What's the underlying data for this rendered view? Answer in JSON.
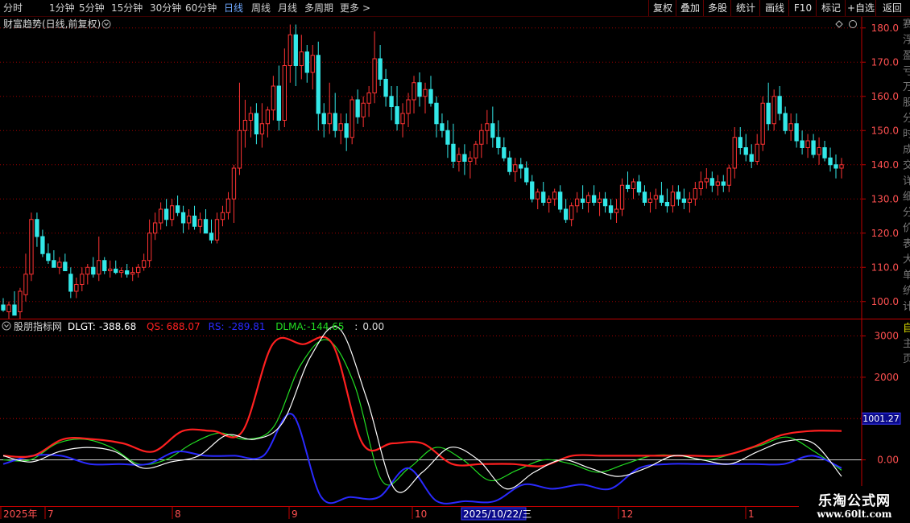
{
  "toolbar": {
    "periods": [
      "分时",
      "1分钟",
      "5分钟",
      "15分钟",
      "30分钟",
      "60分钟",
      "日线",
      "周线",
      "月线",
      "多周期",
      "更多"
    ],
    "active_period": "日线",
    "more_arrow": ">",
    "buttons": [
      "复权",
      "叠加",
      "多股",
      "统计",
      "画线",
      "F10",
      "标记",
      "+自选",
      "返回"
    ]
  },
  "main_panel": {
    "title": "财富趋势(日线,前复权)",
    "y_ticks": [
      "180.0",
      "170.0",
      "160.0",
      "150.0",
      "140.0",
      "130.0",
      "120.0",
      "110.0",
      "100.0"
    ]
  },
  "indicator_panel": {
    "name": "股朋指标网",
    "readouts": [
      {
        "label": "DLGT:",
        "value": "-388.68",
        "color": "#ffffff"
      },
      {
        "label": "QS:",
        "value": "688.07",
        "color": "#ff2020"
      },
      {
        "label": "RS:",
        "value": "-289.81",
        "color": "#2a2aff"
      },
      {
        "label": "DLMA:",
        "value": "-144.65",
        "color": "#22dd22"
      },
      {
        "label": ":",
        "value": "0.00",
        "color": "#dddddd"
      }
    ],
    "y_ticks": [
      "3000",
      "2000",
      "1000",
      "0.00"
    ],
    "cursor_value": "1001.27"
  },
  "time_axis": {
    "labels": [
      "2025年",
      "7",
      "8",
      "9",
      "10",
      "2025/10/22/三",
      "12",
      "1"
    ]
  },
  "side_strip": {
    "top_chars": [
      "赛",
      "浮",
      "盈",
      "亏",
      "万",
      "股",
      "分",
      "时",
      "成",
      "交",
      "详",
      "细",
      "分",
      "价",
      "表",
      "大",
      "单",
      "统",
      "计"
    ],
    "bottom_chars": [
      "自",
      "主",
      "页"
    ]
  },
  "watermark": {
    "title": "乐淘公式网",
    "url": "www.60lt.com"
  },
  "colors": {
    "up": "#ff3333",
    "down": "#33e8e8",
    "grid": "#a00000",
    "axis": "#c00000",
    "ma_white": "#ffffff"
  },
  "chart_data": [
    {
      "type": "candlestick",
      "title": "财富趋势(日线,前复权)",
      "ylim": [
        95,
        183
      ],
      "candles": [
        [
          99,
          101,
          97,
          97.5
        ],
        [
          97,
          100,
          95,
          99
        ],
        [
          99,
          103,
          96,
          96
        ],
        [
          97,
          104,
          95,
          103
        ],
        [
          102,
          114,
          100,
          108
        ],
        [
          108,
          126,
          106,
          124
        ],
        [
          124,
          126,
          116,
          119
        ],
        [
          119,
          121,
          113,
          114
        ],
        [
          114,
          117,
          111,
          112
        ],
        [
          112,
          115,
          110,
          110
        ],
        [
          110,
          113,
          108,
          111.5
        ],
        [
          111.5,
          114,
          109,
          109
        ],
        [
          108,
          110,
          101,
          103
        ],
        [
          103,
          107,
          101,
          105
        ],
        [
          105,
          110,
          103,
          108
        ],
        [
          108,
          111,
          105,
          110
        ],
        [
          110,
          113,
          107,
          108
        ],
        [
          108,
          119,
          106,
          112
        ],
        [
          112,
          113,
          108,
          109
        ],
        [
          109,
          112,
          107,
          109.5
        ],
        [
          109.5,
          112,
          108,
          108.5
        ],
        [
          108.5,
          110,
          107,
          109
        ],
        [
          109,
          111,
          107,
          108
        ],
        [
          108,
          110,
          106,
          108.5
        ],
        [
          108.5,
          111,
          107,
          110
        ],
        [
          110,
          114,
          109,
          112
        ],
        [
          112,
          124,
          110,
          120
        ],
        [
          120,
          126,
          118,
          123
        ],
        [
          123,
          129,
          121,
          127
        ],
        [
          127,
          130,
          122,
          124
        ],
        [
          124,
          130,
          122,
          128
        ],
        [
          128,
          131,
          125,
          126
        ],
        [
          126,
          128,
          120,
          123
        ],
        [
          123,
          127,
          121,
          125
        ],
        [
          125,
          128,
          121,
          122
        ],
        [
          122,
          126,
          120,
          124
        ],
        [
          124,
          127,
          121,
          120
        ],
        [
          120,
          124,
          117,
          118
        ],
        [
          118,
          126,
          117,
          124
        ],
        [
          124,
          128,
          122,
          126
        ],
        [
          126,
          132,
          124,
          130
        ],
        [
          130,
          140,
          123,
          139
        ],
        [
          139,
          164,
          137,
          150
        ],
        [
          150,
          159,
          145,
          153
        ],
        [
          153,
          157,
          148,
          155
        ],
        [
          155,
          158,
          146,
          149
        ],
        [
          149,
          158,
          145,
          152
        ],
        [
          152,
          157,
          148,
          156
        ],
        [
          156,
          166,
          153,
          163
        ],
        [
          163,
          169,
          150,
          153
        ],
        [
          153,
          174,
          151,
          169
        ],
        [
          169,
          181,
          164,
          178
        ],
        [
          178,
          181,
          163,
          169
        ],
        [
          169,
          178,
          165,
          173
        ],
        [
          173,
          175,
          164,
          167
        ],
        [
          167,
          175,
          162,
          172
        ],
        [
          172,
          176,
          150,
          155
        ],
        [
          155,
          158,
          148,
          152
        ],
        [
          152,
          164,
          149,
          155
        ],
        [
          155,
          161,
          148,
          150
        ],
        [
          150,
          155,
          146,
          152
        ],
        [
          152,
          155,
          144,
          148
        ],
        [
          148,
          160,
          146,
          159
        ],
        [
          159,
          162,
          152,
          154
        ],
        [
          154,
          160,
          151,
          158
        ],
        [
          158,
          163,
          154,
          161
        ],
        [
          161,
          179,
          158,
          171
        ],
        [
          171,
          175,
          163,
          165
        ],
        [
          165,
          168,
          157,
          160
        ],
        [
          160,
          163,
          153,
          157
        ],
        [
          157,
          163,
          150,
          152
        ],
        [
          152,
          158,
          148,
          155
        ],
        [
          155,
          161,
          151,
          159
        ],
        [
          159,
          166,
          155,
          164
        ],
        [
          164,
          167,
          157,
          160
        ],
        [
          160,
          164,
          155,
          162
        ],
        [
          162,
          166,
          157,
          158
        ],
        [
          158,
          160,
          148,
          152
        ],
        [
          152,
          155,
          148,
          150
        ],
        [
          150,
          153,
          142,
          146
        ],
        [
          146,
          152,
          139,
          141
        ],
        [
          141,
          145,
          138,
          143
        ],
        [
          143,
          146,
          137,
          141
        ],
        [
          141,
          144,
          136,
          142
        ],
        [
          142,
          147,
          140,
          146
        ],
        [
          146,
          152,
          142,
          150
        ],
        [
          150,
          156,
          146,
          152
        ],
        [
          152,
          157,
          145,
          148
        ],
        [
          148,
          153,
          143,
          145
        ],
        [
          145,
          148,
          141,
          142
        ],
        [
          142,
          144,
          137,
          138
        ],
        [
          138,
          142,
          135,
          140
        ],
        [
          140,
          142,
          136,
          139
        ],
        [
          139,
          141,
          134,
          135
        ],
        [
          135,
          137,
          129,
          130
        ],
        [
          130,
          133,
          127,
          132
        ],
        [
          132,
          135,
          128,
          129
        ],
        [
          129,
          131,
          126,
          130
        ],
        [
          130,
          133,
          128,
          132
        ],
        [
          132,
          134,
          126,
          127
        ],
        [
          127,
          130,
          123,
          124
        ],
        [
          124,
          129,
          122,
          128
        ],
        [
          128,
          132,
          126,
          130
        ],
        [
          130,
          134,
          127,
          129
        ],
        [
          129,
          132,
          126,
          131
        ],
        [
          131,
          134,
          128,
          129
        ],
        [
          129,
          132,
          125,
          130
        ],
        [
          130,
          132,
          126,
          128
        ],
        [
          128,
          130,
          124,
          126
        ],
        [
          126,
          130,
          123,
          127
        ],
        [
          127,
          136,
          125,
          134
        ],
        [
          134,
          138,
          132,
          133
        ],
        [
          133,
          136,
          130,
          135
        ],
        [
          135,
          137,
          131,
          132
        ],
        [
          132,
          134,
          128,
          129
        ],
        [
          129,
          132,
          126,
          130
        ],
        [
          130,
          133,
          127,
          131
        ],
        [
          131,
          135,
          128,
          129
        ],
        [
          129,
          133,
          126,
          128
        ],
        [
          128,
          134,
          126,
          132
        ],
        [
          132,
          134,
          128,
          130
        ],
        [
          130,
          133,
          127,
          129
        ],
        [
          129,
          132,
          126,
          130
        ],
        [
          130,
          135,
          128,
          133
        ],
        [
          133,
          138,
          131,
          135
        ],
        [
          135,
          139,
          133,
          136
        ],
        [
          136,
          138,
          132,
          134
        ],
        [
          134,
          137,
          131,
          135
        ],
        [
          135,
          137,
          132,
          134
        ],
        [
          134,
          140,
          132,
          139
        ],
        [
          139,
          151,
          136,
          148
        ],
        [
          148,
          151,
          143,
          145
        ],
        [
          145,
          149,
          141,
          143
        ],
        [
          143,
          146,
          139,
          141
        ],
        [
          141,
          149,
          140,
          146
        ],
        [
          146,
          160,
          144,
          158
        ],
        [
          158,
          164,
          150,
          152
        ],
        [
          152,
          162,
          150,
          160
        ],
        [
          160,
          163,
          153,
          155
        ],
        [
          155,
          157,
          149,
          150
        ],
        [
          150,
          155,
          147,
          152
        ],
        [
          152,
          155,
          145,
          147
        ],
        [
          147,
          150,
          143,
          145
        ],
        [
          145,
          149,
          142,
          147
        ],
        [
          147,
          149,
          142,
          143
        ],
        [
          143,
          148,
          140,
          145
        ],
        [
          145,
          147,
          141,
          142
        ],
        [
          142,
          145,
          138,
          140
        ],
        [
          140,
          143,
          136,
          139
        ],
        [
          139,
          142,
          136,
          140
        ]
      ]
    },
    {
      "type": "line",
      "title": "股朋指标网",
      "ylim": [
        -1100,
        3400
      ],
      "series": [
        {
          "name": "DLGT",
          "color": "#ffffff",
          "values": [
            100,
            -50,
            200,
            300,
            200,
            -200,
            -50,
            100,
            600,
            500,
            900,
            2500,
            3200,
            1500,
            -700,
            -300,
            300,
            0,
            -700,
            -300,
            0,
            -200,
            -400,
            -200,
            100,
            0,
            -100,
            200,
            450,
            400,
            -400
          ]
        },
        {
          "name": "QS",
          "color": "#ff2020",
          "values": [
            100,
            100,
            500,
            500,
            400,
            200,
            700,
            700,
            700,
            2800,
            2800,
            2800,
            400,
            400,
            400,
            -100,
            -100,
            -100,
            -150,
            100,
            100,
            100,
            100,
            100,
            100,
            300,
            600,
            700,
            700
          ]
        },
        {
          "name": "RS",
          "color": "#2a2aff",
          "values": [
            -100,
            100,
            100,
            -100,
            -100,
            -100,
            200,
            100,
            100,
            100,
            1100,
            -900,
            -900,
            -900,
            -200,
            -1000,
            -1000,
            -1000,
            -600,
            -700,
            -600,
            -700,
            -200,
            -100,
            -100,
            -100,
            -100,
            -100,
            100,
            -200
          ]
        },
        {
          "name": "DLMA",
          "color": "#22dd22",
          "values": [
            0,
            0,
            400,
            500,
            300,
            -100,
            0,
            400,
            650,
            500,
            800,
            2300,
            2900,
            1800,
            -500,
            -200,
            300,
            0,
            -500,
            -250,
            0,
            -100,
            -300,
            -100,
            100,
            100,
            0,
            150,
            350,
            550,
            200,
            -250
          ]
        }
      ]
    }
  ]
}
